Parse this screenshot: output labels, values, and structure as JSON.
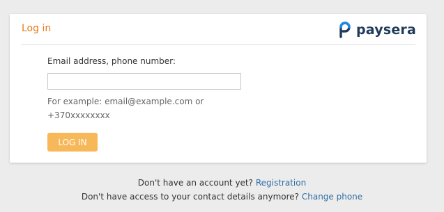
{
  "card": {
    "title": "Log in",
    "logo_text": "paysera",
    "colors": {
      "title": "#e87a1c",
      "logo_mark_blue": "#1e88e5",
      "logo_mark_dark": "#1f3a5a"
    }
  },
  "form": {
    "field_label": "Email address, phone number:",
    "field_value": "",
    "field_placeholder": "",
    "hint": "For example: email@example.com or +370xxxxxxxx",
    "login_button": "LOG IN",
    "login_button_color": "#f7b85a"
  },
  "footer": {
    "no_account_text": "Don't have an account yet?",
    "registration_link": "Registration",
    "no_access_text": "Don't have access to your contact details anymore?",
    "change_phone_link": "Change phone",
    "link_color": "#2f6fa6"
  }
}
